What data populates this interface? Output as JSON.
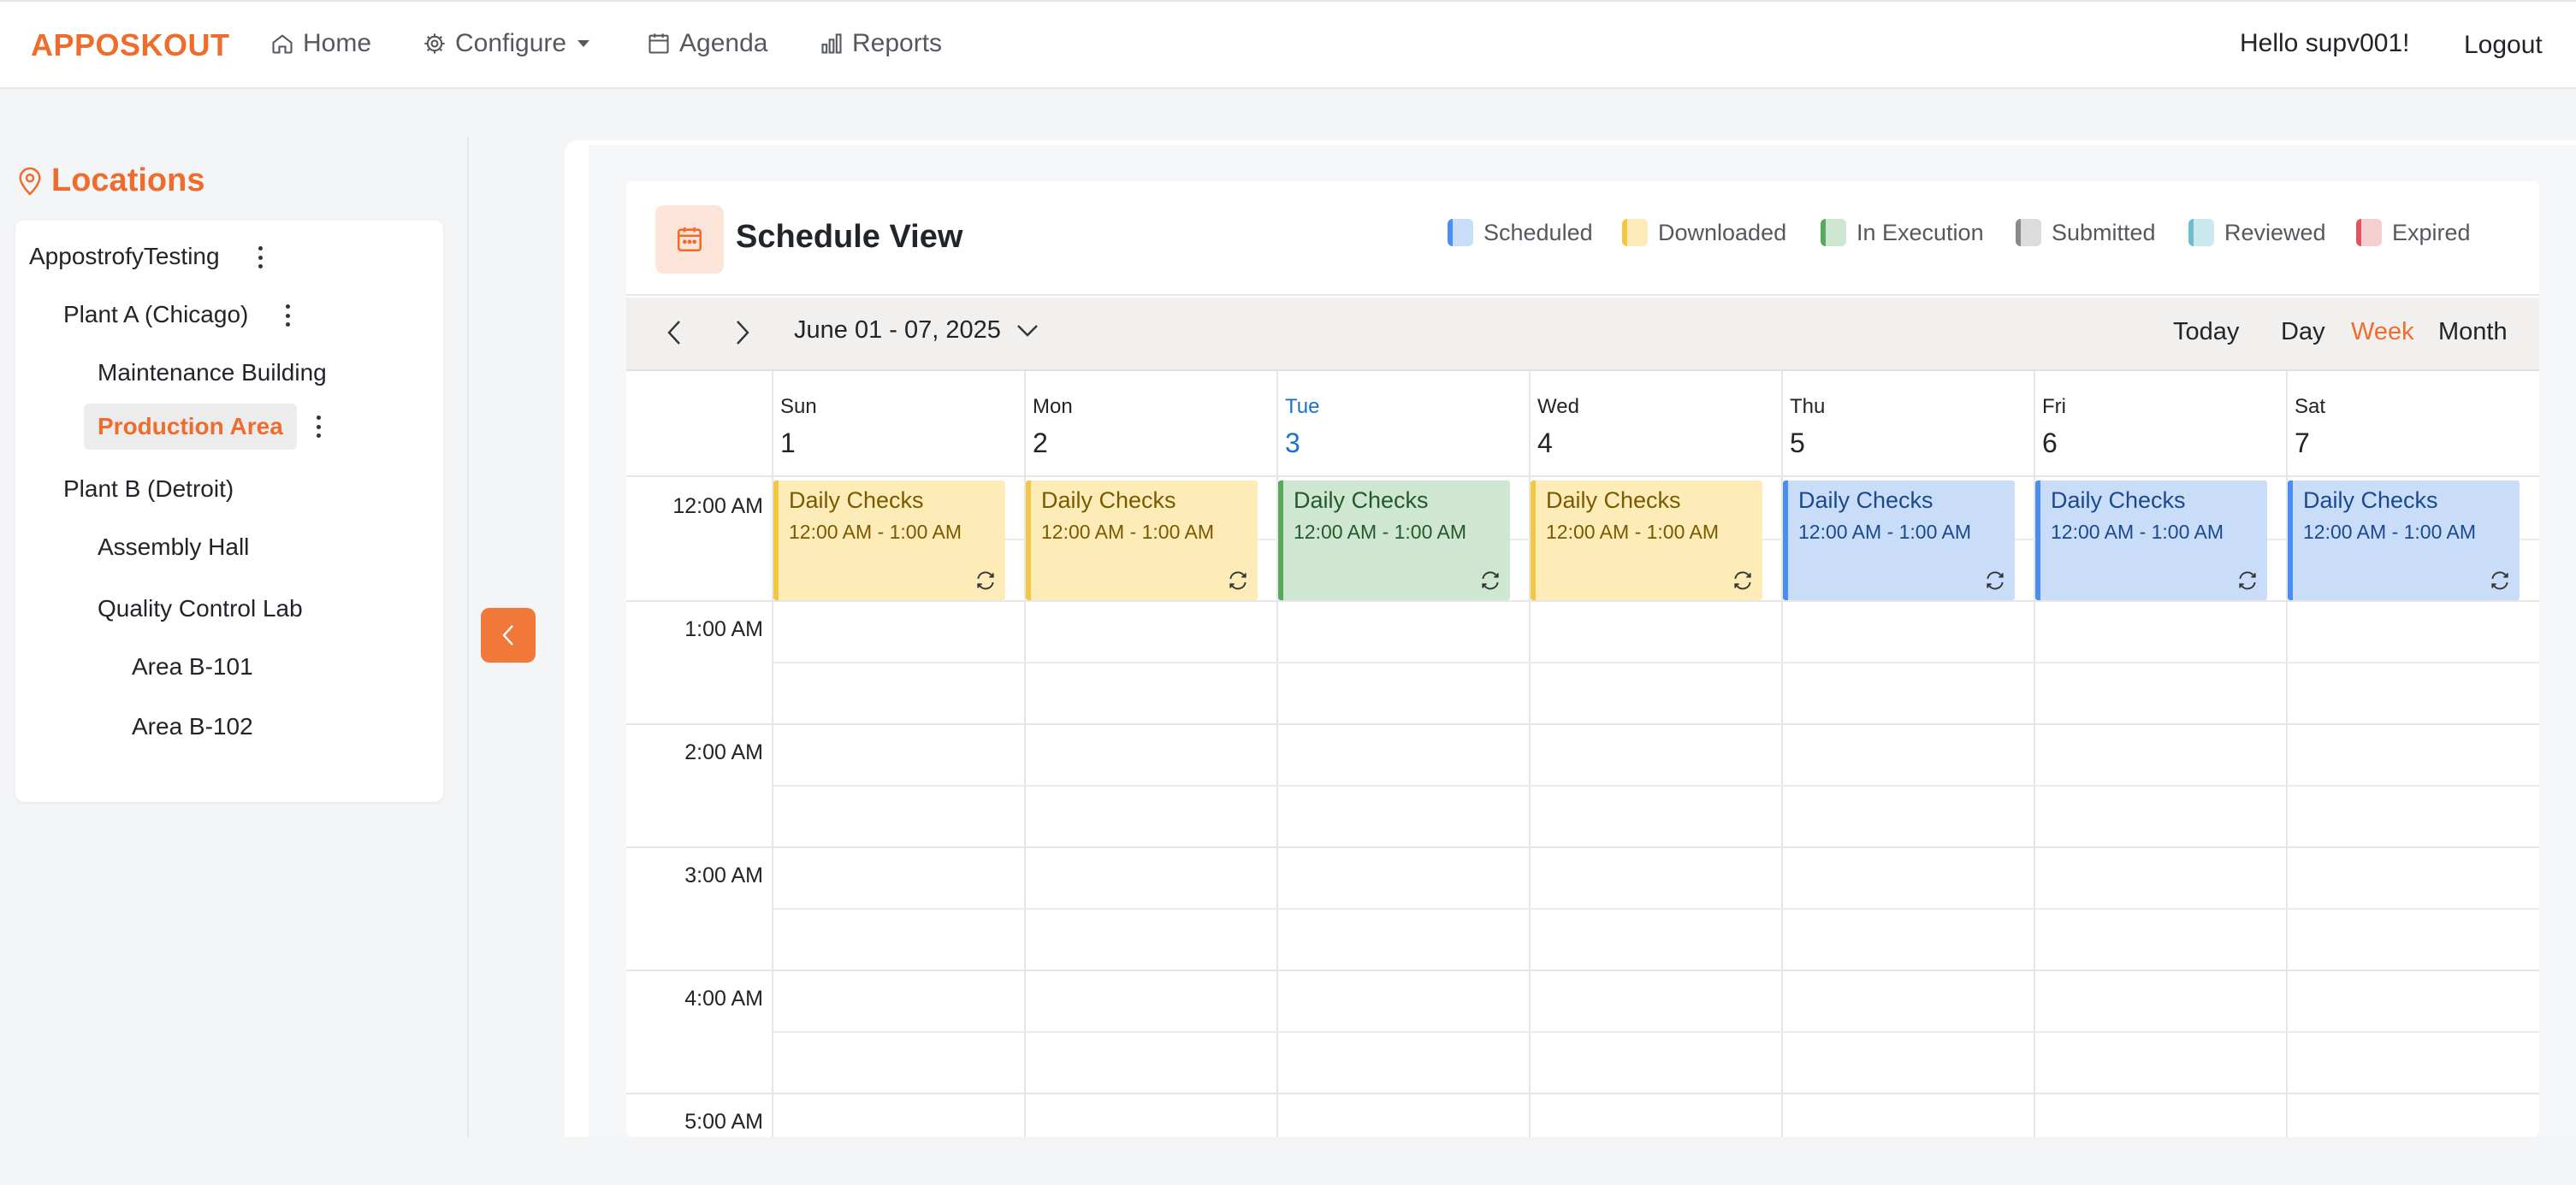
{
  "nav": {
    "brand": "APPOSKOUT",
    "home": "Home",
    "configure": "Configure",
    "agenda": "Agenda",
    "reports": "Reports",
    "greeting": "Hello supv001!",
    "logout": "Logout"
  },
  "sidebar": {
    "title": "Locations",
    "items": [
      {
        "label": "AppostrofyTesting"
      },
      {
        "label": "Plant A (Chicago)"
      },
      {
        "label": "Maintenance Building"
      },
      {
        "label": "Production Area"
      },
      {
        "label": "Plant B (Detroit)"
      },
      {
        "label": "Assembly Hall"
      },
      {
        "label": "Quality Control Lab"
      },
      {
        "label": "Area B-101"
      },
      {
        "label": "Area B-102"
      }
    ]
  },
  "schedule": {
    "title": "Schedule View",
    "legend": [
      {
        "label": "Scheduled",
        "color": "#4a8ff0",
        "fill": "#c9ddf8"
      },
      {
        "label": "Downloaded",
        "color": "#f3c744",
        "fill": "#fdebb8"
      },
      {
        "label": "In Execution",
        "color": "#59a85f",
        "fill": "#cfe6d1"
      },
      {
        "label": "Submitted",
        "color": "#8a8a8a",
        "fill": "#dcdcdc"
      },
      {
        "label": "Reviewed",
        "color": "#6bbfd1",
        "fill": "#cbe8ef"
      },
      {
        "label": "Expired",
        "color": "#e0535f",
        "fill": "#f6cdd1"
      }
    ],
    "range": "June 01 - 07, 2025",
    "views": {
      "today": "Today",
      "day": "Day",
      "week": "Week",
      "month": "Month"
    },
    "active_view": "Week",
    "days": [
      {
        "name": "Sun",
        "num": "1"
      },
      {
        "name": "Mon",
        "num": "2"
      },
      {
        "name": "Tue",
        "num": "3"
      },
      {
        "name": "Wed",
        "num": "4"
      },
      {
        "name": "Thu",
        "num": "5"
      },
      {
        "name": "Fri",
        "num": "6"
      },
      {
        "name": "Sat",
        "num": "7"
      }
    ],
    "today_index": 2,
    "times": [
      "12:00 AM",
      "1:00 AM",
      "2:00 AM",
      "3:00 AM",
      "4:00 AM",
      "5:00 AM"
    ],
    "events": [
      {
        "title": "Daily Checks",
        "time": "12:00 AM - 1:00 AM",
        "status": "Downloaded"
      },
      {
        "title": "Daily Checks",
        "time": "12:00 AM - 1:00 AM",
        "status": "Downloaded"
      },
      {
        "title": "Daily Checks",
        "time": "12:00 AM - 1:00 AM",
        "status": "In Execution"
      },
      {
        "title": "Daily Checks",
        "time": "12:00 AM - 1:00 AM",
        "status": "Downloaded"
      },
      {
        "title": "Daily Checks",
        "time": "12:00 AM - 1:00 AM",
        "status": "Scheduled"
      },
      {
        "title": "Daily Checks",
        "time": "12:00 AM - 1:00 AM",
        "status": "Scheduled"
      },
      {
        "title": "Daily Checks",
        "time": "12:00 AM - 1:00 AM",
        "status": "Scheduled"
      }
    ],
    "status_text_colors": {
      "Downloaded": "#7a5a00",
      "In Execution": "#245a2a",
      "Scheduled": "#1a4a8c"
    }
  }
}
